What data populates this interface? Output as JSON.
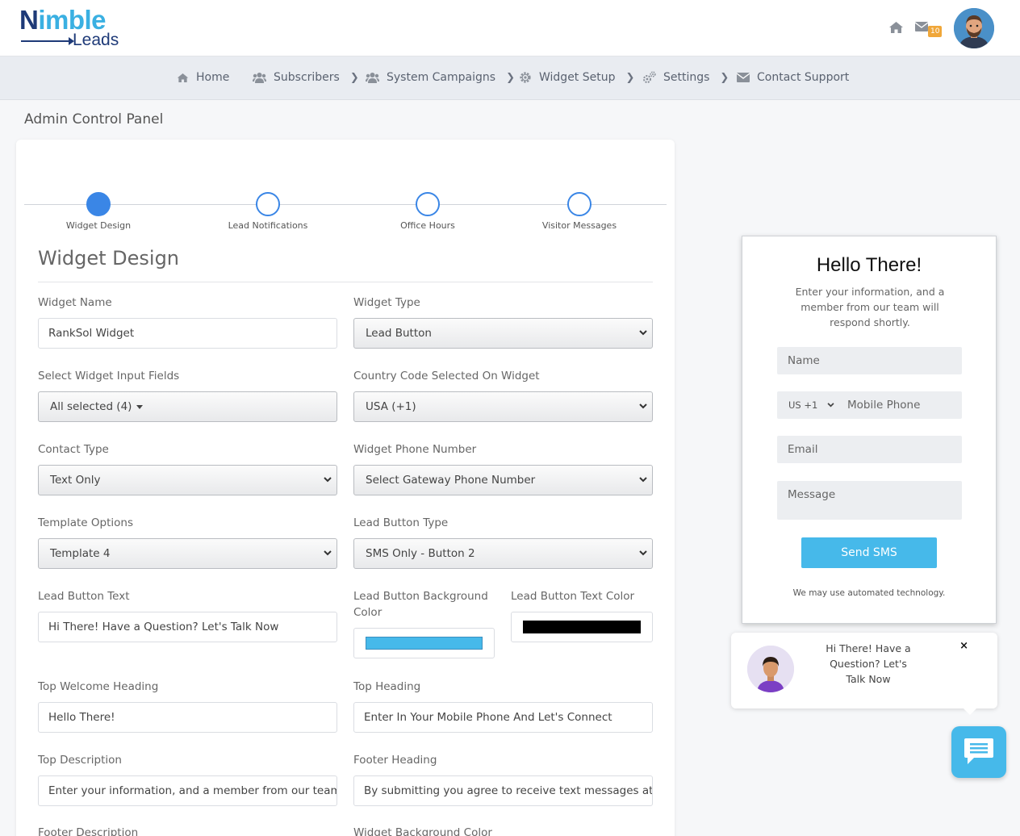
{
  "brand": {
    "logo_part1": "N",
    "logo_part2": "imble",
    "logo_part3": "Leads"
  },
  "header": {
    "mail_count": "10"
  },
  "nav": [
    {
      "label": "Home",
      "icon": "home-icon"
    },
    {
      "label": "Subscribers",
      "icon": "users-icon"
    },
    {
      "label": "System Campaigns",
      "icon": "users-icon"
    },
    {
      "label": "Widget Setup",
      "icon": "gear-icon"
    },
    {
      "label": "Settings",
      "icon": "gears-icon"
    },
    {
      "label": "Contact Support",
      "icon": "envelope-icon"
    }
  ],
  "page_title": "Admin Control Panel",
  "steps": [
    {
      "label": "Widget Design",
      "active": true
    },
    {
      "label": "Lead Notifications",
      "active": false
    },
    {
      "label": "Office Hours",
      "active": false
    },
    {
      "label": "Visitor Messages",
      "active": false
    }
  ],
  "section_title": "Widget Design",
  "form": {
    "widget_name": {
      "label": "Widget Name",
      "value": "RankSol Widget"
    },
    "widget_type": {
      "label": "Widget Type",
      "value": "Lead Button"
    },
    "input_fields": {
      "label": "Select Widget Input Fields",
      "value": "All selected (4)"
    },
    "country_code": {
      "label": "Country Code Selected On Widget",
      "value": "USA (+1)"
    },
    "contact_type": {
      "label": "Contact Type",
      "value": "Text Only"
    },
    "phone_number": {
      "label": "Widget Phone Number",
      "value": "Select Gateway Phone Number"
    },
    "template": {
      "label": "Template Options",
      "value": "Template 4"
    },
    "button_type": {
      "label": "Lead Button Type",
      "value": "SMS Only - Button 2"
    },
    "button_text": {
      "label": "Lead Button Text",
      "value": "Hi There! Have a Question? Let's Talk Now"
    },
    "button_bg": {
      "label": "Lead Button Background Color",
      "color": "#46b9ea"
    },
    "button_text_color": {
      "label": "Lead Button Text Color",
      "color": "#000000"
    },
    "welcome_heading": {
      "label": "Top Welcome Heading",
      "value": "Hello There!"
    },
    "top_heading": {
      "label": "Top Heading",
      "value": "Enter In Your Mobile Phone And Let's Connect"
    },
    "top_description": {
      "label": "Top Description",
      "value": "Enter your information, and a member from our team"
    },
    "footer_heading": {
      "label": "Footer Heading",
      "value": "By submitting you agree to receive text messages at"
    },
    "footer_description": {
      "label": "Footer Description"
    },
    "widget_bg": {
      "label": "Widget Background Color"
    }
  },
  "preview": {
    "title": "Hello There!",
    "description": "Enter your information, and a member from our team will respond shortly.",
    "name_placeholder": "Name",
    "country_code": "US +1",
    "phone_placeholder": "Mobile Phone",
    "email_placeholder": "Email",
    "message_placeholder": "Message",
    "send_label": "Send SMS",
    "footer": "We may use automated technology."
  },
  "popup": {
    "text": "Hi There! Have a Question? Let's Talk Now",
    "close": "×"
  },
  "colors": {
    "accent": "#3a86e6",
    "brand_blue": "#46b9ea",
    "brand_navy": "#1e3a78",
    "badge": "#f0a73a"
  }
}
